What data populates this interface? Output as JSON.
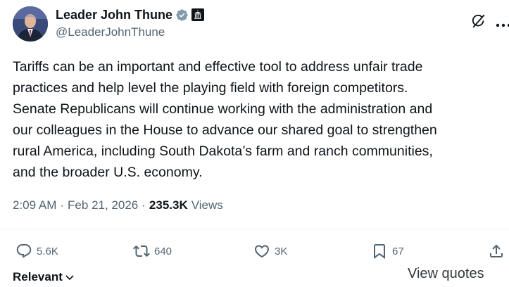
{
  "author": {
    "display_name": "Leader John Thune",
    "handle": "@LeaderJohnThune",
    "verified_icon": "verified-badge-icon",
    "affiliation_icon": "government-badge-icon"
  },
  "tweet": {
    "text": "Tariffs can be an important and effective tool to address unfair trade\npractices and help level the playing field with foreign competitors.\nSenate Republicans will continue working with the administration and\nour colleagues in the House to advance our shared goal to strengthen\nrural America, including South Dakota’s farm and ranch communities,\nand the broader U.S. economy."
  },
  "meta": {
    "time": "2:09 AM",
    "separator": "·",
    "date": "Feb 21, 2026",
    "views_count": "235.3K",
    "views_label": "Views"
  },
  "actions": {
    "replies": "5.6K",
    "reposts": "640",
    "likes": "3K",
    "bookmarks": "67"
  },
  "footer": {
    "sort_label": "Relevant",
    "view_quotes_label": "View quotes"
  },
  "colors": {
    "text_primary": "#0f1419",
    "text_secondary": "#536471",
    "verified_blue": "#1d9bf0",
    "divider": "#eff3f4"
  }
}
